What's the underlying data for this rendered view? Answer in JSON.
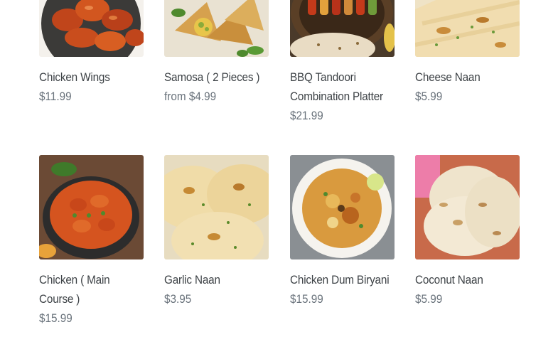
{
  "products": [
    {
      "title": "Chicken Wings",
      "price": "$11.99",
      "image": "chicken-wings-photo"
    },
    {
      "title": "Samosa ( 2 Pieces )",
      "price": "from $4.99",
      "image": "samosa-photo"
    },
    {
      "title": "BBQ Tandoori Combination Platter",
      "price": "$21.99",
      "image": "tandoori-platter-photo"
    },
    {
      "title": "Cheese Naan",
      "price": "$5.99",
      "image": "cheese-naan-photo"
    },
    {
      "title": "Chicken ( Main Course )",
      "price": "$15.99",
      "image": "chicken-curry-photo"
    },
    {
      "title": "Garlic Naan",
      "price": "$3.95",
      "image": "garlic-naan-photo"
    },
    {
      "title": "Chicken Dum Biryani",
      "price": "$15.99",
      "image": "biryani-photo"
    },
    {
      "title": "Coconut Naan",
      "price": "$5.99",
      "image": "coconut-naan-photo"
    }
  ]
}
